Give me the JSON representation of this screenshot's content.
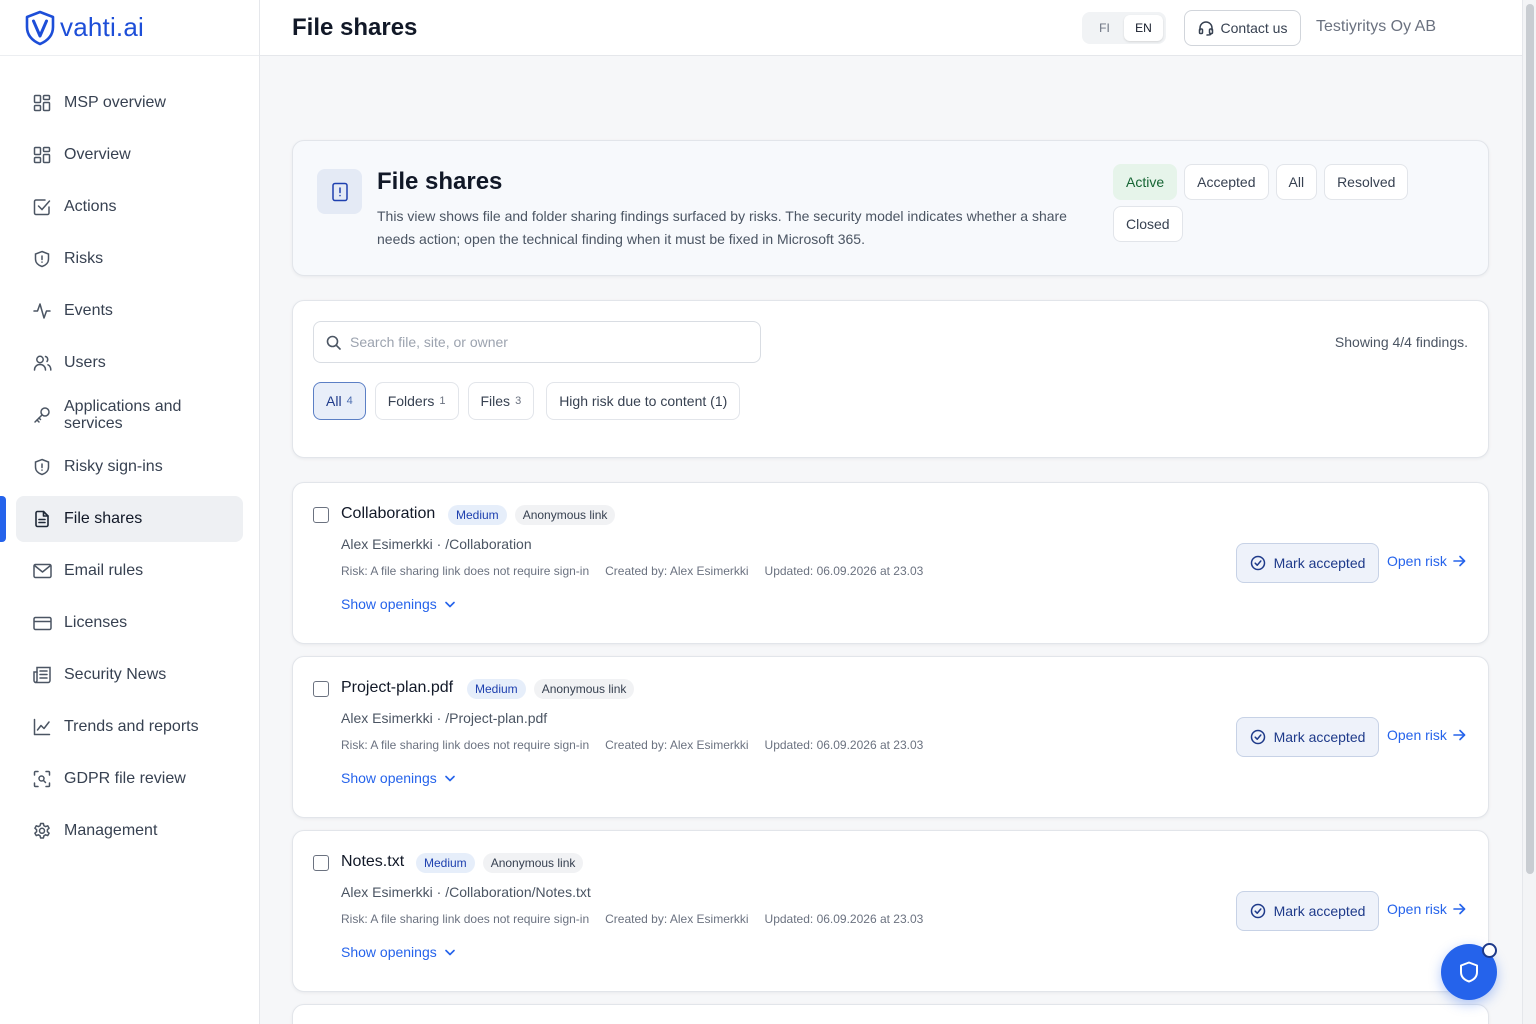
{
  "brand": {
    "name": "vahti.ai",
    "accent": "#2563eb"
  },
  "sidebar": {
    "items": [
      {
        "label": "MSP overview",
        "icon": "grid-icon"
      },
      {
        "label": "Overview",
        "icon": "grid-icon"
      },
      {
        "label": "Actions",
        "icon": "checkbox-icon"
      },
      {
        "label": "Risks",
        "icon": "shield-alert-icon"
      },
      {
        "label": "Events",
        "icon": "activity-icon"
      },
      {
        "label": "Users",
        "icon": "users-icon"
      },
      {
        "label": "Applications and services",
        "icon": "key-icon"
      },
      {
        "label": "Risky sign-ins",
        "icon": "shield-alert-icon"
      },
      {
        "label": "File shares",
        "icon": "file-icon",
        "active": true
      },
      {
        "label": "Email rules",
        "icon": "mail-icon"
      },
      {
        "label": "Licenses",
        "icon": "card-icon"
      },
      {
        "label": "Security News",
        "icon": "newspaper-icon"
      },
      {
        "label": "Trends and reports",
        "icon": "chart-icon"
      },
      {
        "label": "GDPR file review",
        "icon": "scan-icon"
      },
      {
        "label": "Management",
        "icon": "gear-icon"
      }
    ]
  },
  "header": {
    "title": "File shares",
    "lang": {
      "fi": "FI",
      "en": "EN",
      "selected": "EN"
    },
    "contact_label": "Contact us",
    "org_name": "Testiyritys Oy AB"
  },
  "hero": {
    "title": "File shares",
    "description": "This view shows file and folder sharing findings surfaced by risks. The security model indicates whether a share needs action; open the technical finding when it must be fixed in Microsoft 365.",
    "status_tabs": [
      "Active",
      "Accepted",
      "All",
      "Resolved",
      "Closed"
    ],
    "selected_status": "Active"
  },
  "filters": {
    "search_placeholder": "Search file, site, or owner",
    "search_value": "",
    "showing": "Showing 4/4 findings.",
    "types": [
      {
        "label": "All",
        "count": "4",
        "selected": true
      },
      {
        "label": "Folders",
        "count": "1"
      },
      {
        "label": "Files",
        "count": "3"
      },
      {
        "label": "High risk due to content (1)",
        "count": ""
      }
    ]
  },
  "findings": [
    {
      "name": "Collaboration",
      "severity": "Medium",
      "type": "Anonymous link",
      "owner_path": "Alex Esimerkki · /Collaboration",
      "risk": "Risk: A file sharing link does not require sign-in",
      "created_by": "Created by: Alex Esimerkki",
      "updated": "Updated: 06.09.2026 at 23.03",
      "show_openings": "Show openings",
      "accept_label": "Mark accepted",
      "open_label": "Open risk"
    },
    {
      "name": "Project-plan.pdf",
      "severity": "Medium",
      "type": "Anonymous link",
      "owner_path": "Alex Esimerkki · /Project-plan.pdf",
      "risk": "Risk: A file sharing link does not require sign-in",
      "created_by": "Created by: Alex Esimerkki",
      "updated": "Updated: 06.09.2026 at 23.03",
      "show_openings": "Show openings",
      "accept_label": "Mark accepted",
      "open_label": "Open risk"
    },
    {
      "name": "Notes.txt",
      "severity": "Medium",
      "type": "Anonymous link",
      "owner_path": "Alex Esimerkki · /Collaboration/Notes.txt",
      "risk": "Risk: A file sharing link does not require sign-in",
      "created_by": "Created by: Alex Esimerkki",
      "updated": "Updated: 06.09.2026 at 23.03",
      "show_openings": "Show openings",
      "accept_label": "Mark accepted",
      "open_label": "Open risk"
    }
  ]
}
